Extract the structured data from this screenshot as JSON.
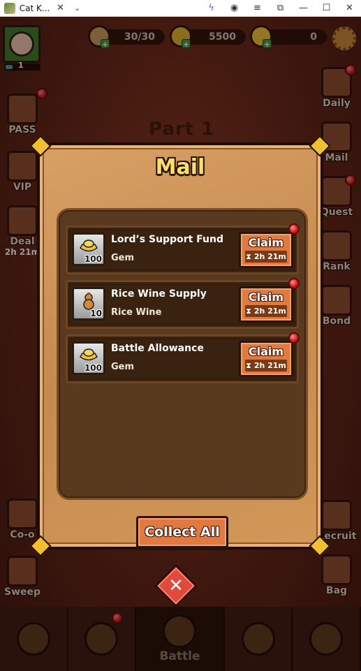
{
  "window": {
    "tab_title": "Cat K...",
    "tab_close": "✕",
    "tab_menu": "⌄",
    "controls": [
      "ϟ",
      "◉",
      "≡",
      "⧉",
      "—",
      "☐",
      "✕"
    ]
  },
  "status": {
    "level": "1",
    "level_progress_pct": 20,
    "stamina": "30/30",
    "coins": "5500",
    "gems": "0"
  },
  "side_left": [
    {
      "label": "PASS"
    },
    {
      "label": "VIP"
    },
    {
      "label": "Deal",
      "sub": "2h 21m"
    },
    {
      "label": "Co-o"
    },
    {
      "label": "Sweep"
    }
  ],
  "side_right": [
    {
      "label": "Daily"
    },
    {
      "label": "Mail"
    },
    {
      "label": "Quest"
    },
    {
      "label": "Rank"
    },
    {
      "label": "Bond"
    },
    {
      "label": "Recruit"
    },
    {
      "label": "Bag"
    }
  ],
  "stage": {
    "title": "Part 1"
  },
  "mail": {
    "title": "Mail",
    "items": [
      {
        "title": "Lord’s Support Fund",
        "reward": "Gem",
        "count": "100",
        "icon": "gem-ingot-icon",
        "claim": "Claim",
        "timer": "2h 21m"
      },
      {
        "title": "Rice Wine Supply",
        "reward": "Rice Wine",
        "count": "10",
        "icon": "rice-wine-gourd-icon",
        "claim": "Claim",
        "timer": "2h 21m"
      },
      {
        "title": "Battle Allowance",
        "reward": "Gem",
        "count": "100",
        "icon": "gem-ingot-icon",
        "claim": "Claim",
        "timer": "2h 21m"
      }
    ],
    "collect_all": "Collect All",
    "close": "✕"
  },
  "bottom_nav": {
    "active_label": "Battle"
  },
  "colors": {
    "claim_button": "#e07a40",
    "mail_title": "#f8e070",
    "notification": "#d01818"
  }
}
